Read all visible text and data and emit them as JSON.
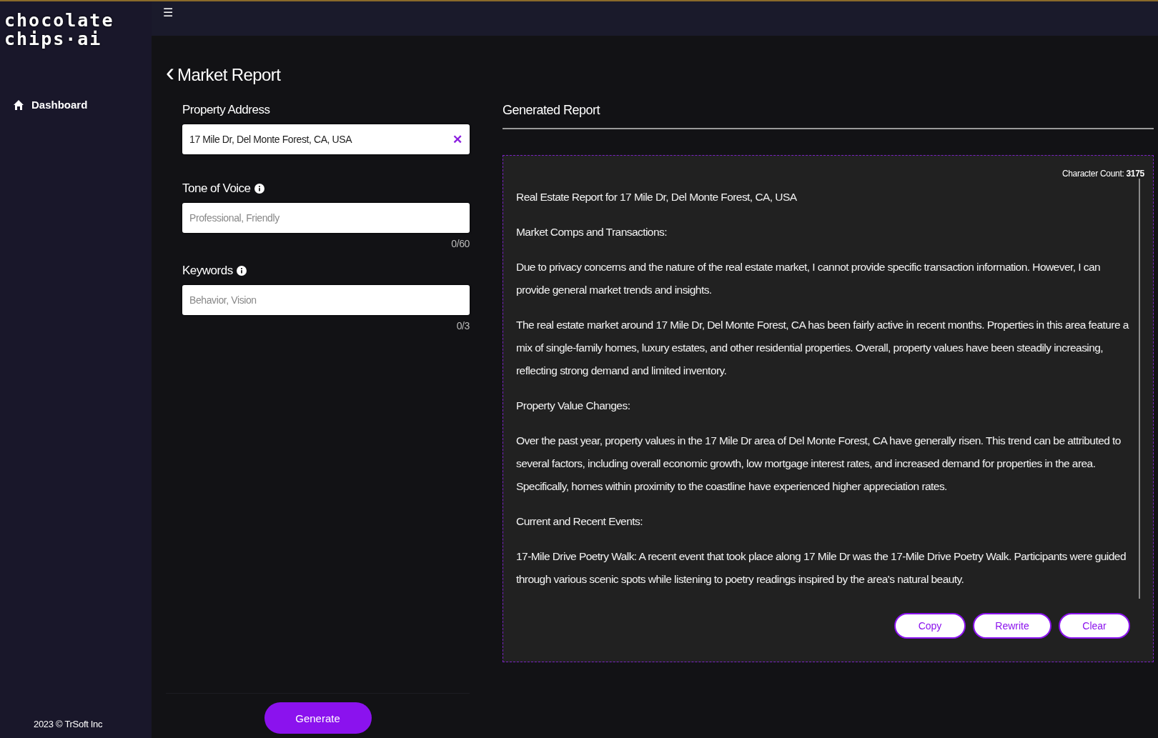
{
  "sidebar": {
    "logo": [
      "chocolate",
      "chips·ai"
    ],
    "items": [
      {
        "label": "Dashboard",
        "selected": true
      }
    ],
    "footer": "2023 © TrSoft Inc"
  },
  "topbar": {
    "menu_glyph": "☰"
  },
  "page": {
    "back_glyph": "‹",
    "title": "Market Report"
  },
  "form": {
    "fields": [
      {
        "label": "Property Address",
        "info": false,
        "value": "17 Mile Dr, Del Monte Forest, CA, USA",
        "clear_glyph": "✕"
      },
      {
        "label": "Tone of Voice",
        "info": true,
        "placeholder": "Professional, Friendly",
        "counter": "0/60"
      },
      {
        "label": "Keywords",
        "info": true,
        "placeholder": "Behavior, Vision",
        "counter": "0/3"
      }
    ],
    "generate_button": "Generate"
  },
  "report": {
    "heading": "Generated Report",
    "character_count": "Character Count: **3175**",
    "paragraphs": [
      "Real Estate Report for 17 Mile Dr, Del Monte Forest, CA, USA",
      "Market Comps and Transactions:",
      "Due to privacy concerns and the nature of the real estate market, I cannot provide specific transaction information. However, I can provide general market trends and insights.",
      "The real estate market around 17 Mile Dr, Del Monte Forest, CA has been fairly active in recent months. Properties in this area feature a mix of single-family homes, luxury estates, and other residential properties. Overall, property values have been steadily increasing, reflecting strong demand and limited inventory.",
      "Property Value Changes:",
      "Over the past year, property values in the 17 Mile Dr area of Del Monte Forest, CA have generally risen. This trend can be attributed to several factors, including overall economic growth, low mortgage interest rates, and increased demand for properties in the area. Specifically, homes within proximity to the coastline have experienced higher appreciation rates.",
      "Current and Recent Events:",
      "17-Mile Drive Poetry Walk: A recent event that took place along 17 Mile Dr was the 17-Mile Drive Poetry Walk. Participants were guided through various scenic spots while listening to poetry readings inspired by the area's natural beauty."
    ],
    "buttons": [
      "Copy",
      "Rewrite",
      "Clear"
    ]
  }
}
